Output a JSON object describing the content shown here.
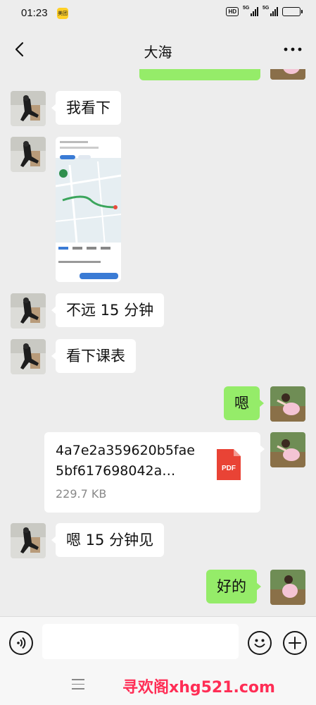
{
  "status_bar": {
    "time": "01:23",
    "app_badge": "美团",
    "hd_label": "HD",
    "signal_1_label": "5G",
    "signal_2_label": "5G"
  },
  "header": {
    "title": "大海",
    "back_icon": "chevron-left-icon",
    "more_icon": "more-dots-icon"
  },
  "messages": [
    {
      "side": "in",
      "type": "text",
      "text": "我看下"
    },
    {
      "side": "in",
      "type": "image",
      "description": "map-screenshot"
    },
    {
      "side": "in",
      "type": "text",
      "text": "不远 15 分钟"
    },
    {
      "side": "in",
      "type": "text",
      "text": "看下课表"
    },
    {
      "side": "out",
      "type": "text",
      "text": "嗯"
    },
    {
      "side": "out",
      "type": "file",
      "file_name": "4a7e2a359620b5fae5bf617698042a…",
      "file_size": "229.7 KB",
      "file_type": "PDF"
    },
    {
      "side": "in",
      "type": "text",
      "text": "嗯 15 分钟见"
    },
    {
      "side": "out",
      "type": "text",
      "text": "好的"
    }
  ],
  "input_bar": {
    "voice_icon": "voice-icon",
    "emoji_icon": "emoji-icon",
    "plus_icon": "plus-icon",
    "placeholder": ""
  },
  "bottom_nav": {
    "menu_icon": "menu-icon",
    "watermark": "寻欢阁xhg521.com"
  },
  "colors": {
    "background": "#ededed",
    "outgoing_bubble": "#95ec69",
    "incoming_bubble": "#ffffff",
    "watermark": "#ff2d55",
    "pdf_red": "#e94335"
  }
}
